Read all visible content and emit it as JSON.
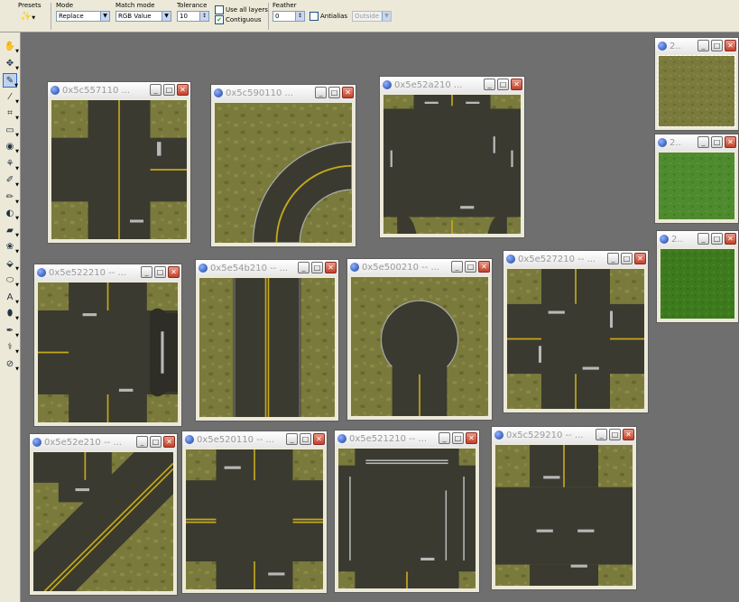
{
  "options_bar": {
    "presets_label": "Presets",
    "mode_label": "Mode",
    "mode_value": "Replace",
    "match_mode_label": "Match mode",
    "match_mode_value": "RGB Value",
    "tolerance_label": "Tolerance",
    "tolerance_value": "10",
    "use_all_layers_label": "Use all layers",
    "use_all_layers_checked": false,
    "contiguous_label": "Contiguous",
    "contiguous_checked": true,
    "feather_label": "Feather",
    "feather_value": "0",
    "antialias_label": "Antialias",
    "antialias_checked": false,
    "antialias_mode_value": "Outside"
  },
  "toolbox": {
    "tools": [
      {
        "name": "pan-tool-icon",
        "glyph": "✋",
        "selected": false
      },
      {
        "name": "move-tool-icon",
        "glyph": "✥",
        "selected": false
      },
      {
        "name": "magic-wand-tool-icon",
        "glyph": "✎",
        "selected": true
      },
      {
        "name": "dropper-tool-icon",
        "glyph": "⁄",
        "selected": false
      },
      {
        "name": "crop-tool-icon",
        "glyph": "⌗",
        "selected": false
      },
      {
        "name": "selection-tool-icon",
        "glyph": "▭",
        "selected": false
      },
      {
        "name": "red-eye-tool-icon",
        "glyph": "◉",
        "selected": false
      },
      {
        "name": "clone-tool-icon",
        "glyph": "⚘",
        "selected": false
      },
      {
        "name": "scratch-remover-icon",
        "glyph": "✐",
        "selected": false
      },
      {
        "name": "paint-brush-icon",
        "glyph": "✏",
        "selected": false
      },
      {
        "name": "lighten-darken-icon",
        "glyph": "◐",
        "selected": false
      },
      {
        "name": "eraser-icon",
        "glyph": "▰",
        "selected": false
      },
      {
        "name": "picture-tube-icon",
        "glyph": "❀",
        "selected": false
      },
      {
        "name": "flood-fill-icon",
        "glyph": "⬙",
        "selected": false
      },
      {
        "name": "shape-tool-icon",
        "glyph": "⬭",
        "selected": false
      },
      {
        "name": "text-tool-icon",
        "glyph": "A",
        "selected": false
      },
      {
        "name": "preset-shape-icon",
        "glyph": "⬮",
        "selected": false
      },
      {
        "name": "pen-tool-icon",
        "glyph": "✒",
        "selected": false
      },
      {
        "name": "warp-brush-icon",
        "glyph": "⚕",
        "selected": false
      },
      {
        "name": "mesh-warp-icon",
        "glyph": "⊘",
        "selected": false
      }
    ]
  },
  "colors": {
    "workspace": "#6f6f6f",
    "grass": "#7a7a3c",
    "asphalt": "#3a3a30",
    "lane_yellow": "#c4a81c",
    "lane_white": "#b8b8b8",
    "green_grass": "#4e8a2e",
    "dark_green_grass": "#3d7a1e"
  },
  "windows": [
    {
      "id": "0x5c557110",
      "title": "0x5c557110 ...",
      "tile": "cross-vertical"
    },
    {
      "id": "0x5c590110",
      "title": "0x5c590110 ...",
      "tile": "curve"
    },
    {
      "id": "0x5e52a210",
      "title": "0x5e52a210 ...",
      "tile": "plaza"
    },
    {
      "id": "0x5e522210",
      "title": "0x5e522210 -- ...",
      "tile": "t-right"
    },
    {
      "id": "0x5e54b210",
      "title": "0x5e54b210 -- ...",
      "tile": "straight-vertical"
    },
    {
      "id": "0x5e500210",
      "title": "0x5e500210 -- ...",
      "tile": "cul-de-sac"
    },
    {
      "id": "0x5e527210",
      "title": "0x5e527210 -- ...",
      "tile": "cross-small"
    },
    {
      "id": "0x5e52e210",
      "title": "0x5e52e210 -- ...",
      "tile": "diagonal"
    },
    {
      "id": "0x5e520110",
      "title": "0x5e520110 -- ...",
      "tile": "cross-wide"
    },
    {
      "id": "0x5e521210",
      "title": "0x5e521210 -- ...",
      "tile": "plaza-wide"
    },
    {
      "id": "0x5c529210",
      "title": "0x5c529210 -- ...",
      "tile": "t-horizontal"
    },
    {
      "id": "small-1",
      "title": "2...",
      "tile": "grass"
    },
    {
      "id": "small-2",
      "title": "2...",
      "tile": "green"
    },
    {
      "id": "small-3",
      "title": "2...",
      "tile": "dark-green"
    }
  ]
}
